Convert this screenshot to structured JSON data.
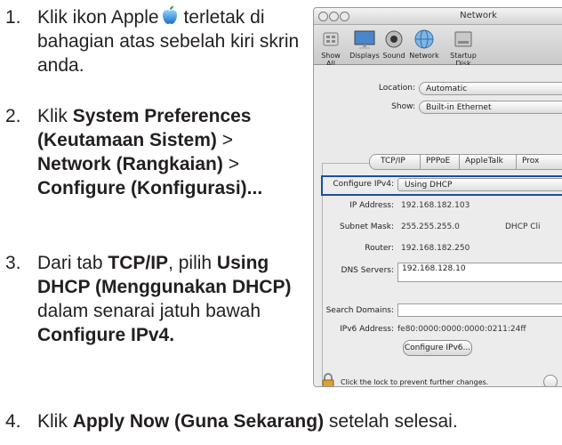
{
  "instructions": {
    "step1": {
      "number": "1.",
      "text": "Klik ikon Apple terletak di bahagian atas sebelah kiri skrin anda."
    },
    "step2": {
      "number": "2.",
      "pre": "Klik ",
      "bold1": "System Preferences (Keutamaan Sistem)",
      "sep1": " > ",
      "bold2": "Network (Rangkaian)",
      "sep2": " > ",
      "bold3": "Configure (Konfigurasi)..."
    },
    "step3": {
      "number": "3.",
      "pre": "Dari tab ",
      "bold1": "TCP/IP",
      "mid1": ", pilih ",
      "bold2": "Using DHCP (Menggunakan DHCP)",
      "mid2": " dalam senarai jatuh bawah ",
      "bold3": "Configure IPv4."
    },
    "step4": {
      "number": "4.",
      "pre": "Klik ",
      "bold": "Apply Now (Guna Sekarang)",
      "post": " setelah selesai."
    }
  },
  "window": {
    "title": "Network",
    "toolbar": [
      {
        "label": "Show All",
        "icon": "show-all-icon"
      },
      {
        "label": "Displays",
        "icon": "displays-icon"
      },
      {
        "label": "Sound",
        "icon": "sound-icon"
      },
      {
        "label": "Network",
        "icon": "network-icon"
      },
      {
        "label": "Startup Disk",
        "icon": "startup-disk-icon"
      }
    ],
    "location_label": "Location:",
    "location_value": "Automatic",
    "show_label": "Show:",
    "show_value": "Built-in Ethernet",
    "tabs": [
      "TCP/IP",
      "PPPoE",
      "AppleTalk",
      "Prox"
    ],
    "configure_label": "Configure IPv4:",
    "configure_value": "Using DHCP",
    "ip_label": "IP Address:",
    "ip_value": "192.168.182.103",
    "subnet_label": "Subnet Mask:",
    "subnet_value": "255.255.255.0",
    "dhcp_label": "DHCP Cli",
    "router_label": "Router:",
    "router_value": "192.168.182.250",
    "dns_label": "DNS Servers:",
    "dns_value": "192.168.128.10",
    "search_label": "Search Domains:",
    "search_value": "",
    "ipv6_label": "IPv6 Address:",
    "ipv6_value": "fe80:0000:0000:0000:0211:24ff",
    "configure_ipv6_button": "Configure IPv6...",
    "lock_text": "Click the lock to prevent further changes."
  },
  "colors": {
    "highlight": "#1a4fa3",
    "apple_blue": "#3d8fe0"
  }
}
